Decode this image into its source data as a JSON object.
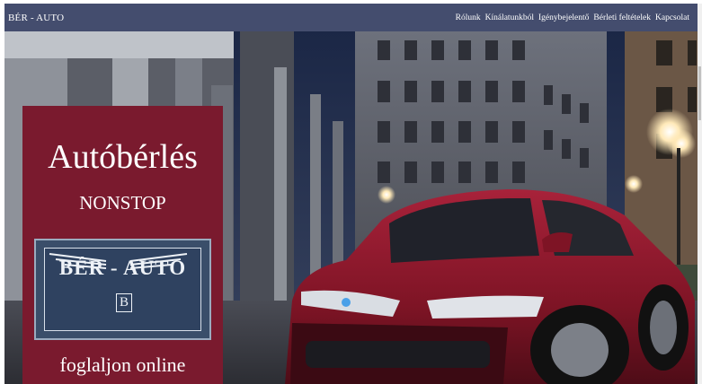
{
  "navbar": {
    "brand": "BÉR - AUTO",
    "links": [
      "Rólunk",
      "Kínálatunkból",
      "Igénybejelentő",
      "Bérleti feltételek",
      "Kapcsolat"
    ]
  },
  "hero": {
    "title": "Autóbérlés",
    "subtitle": "NONSTOP",
    "logo_text": "BÉR - AUTO",
    "logo_letter": "B",
    "cta": "foglaljon online"
  },
  "colors": {
    "navbar": "#444d6e",
    "panel": "#7a1a2e",
    "car": "#8c1727",
    "sky": "#1d2a4a"
  },
  "icons": {
    "logo": "winged-b-emblem-icon",
    "scene": "city-street-car-photo"
  }
}
